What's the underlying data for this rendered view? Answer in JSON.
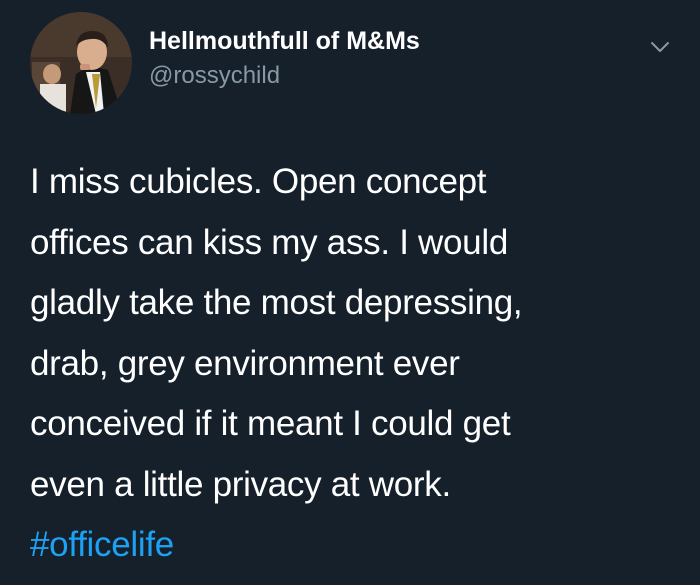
{
  "user": {
    "display_name": "Hellmouthfull of M&Ms",
    "handle": "@rossychild",
    "avatar_icon": "profile-photo"
  },
  "menu": {
    "icon": "chevron-down-icon"
  },
  "tweet": {
    "lines": [
      "I miss cubicles. Open concept",
      "offices can kiss my ass. I would",
      "gladly take the most depressing,",
      "drab, grey environment ever",
      "conceived if it meant I could get",
      "even a little privacy at work."
    ],
    "hashtag": "#officelife"
  },
  "colors": {
    "background": "#15202b",
    "text": "#ffffff",
    "secondary": "#8899a6",
    "link": "#1da1f2"
  }
}
